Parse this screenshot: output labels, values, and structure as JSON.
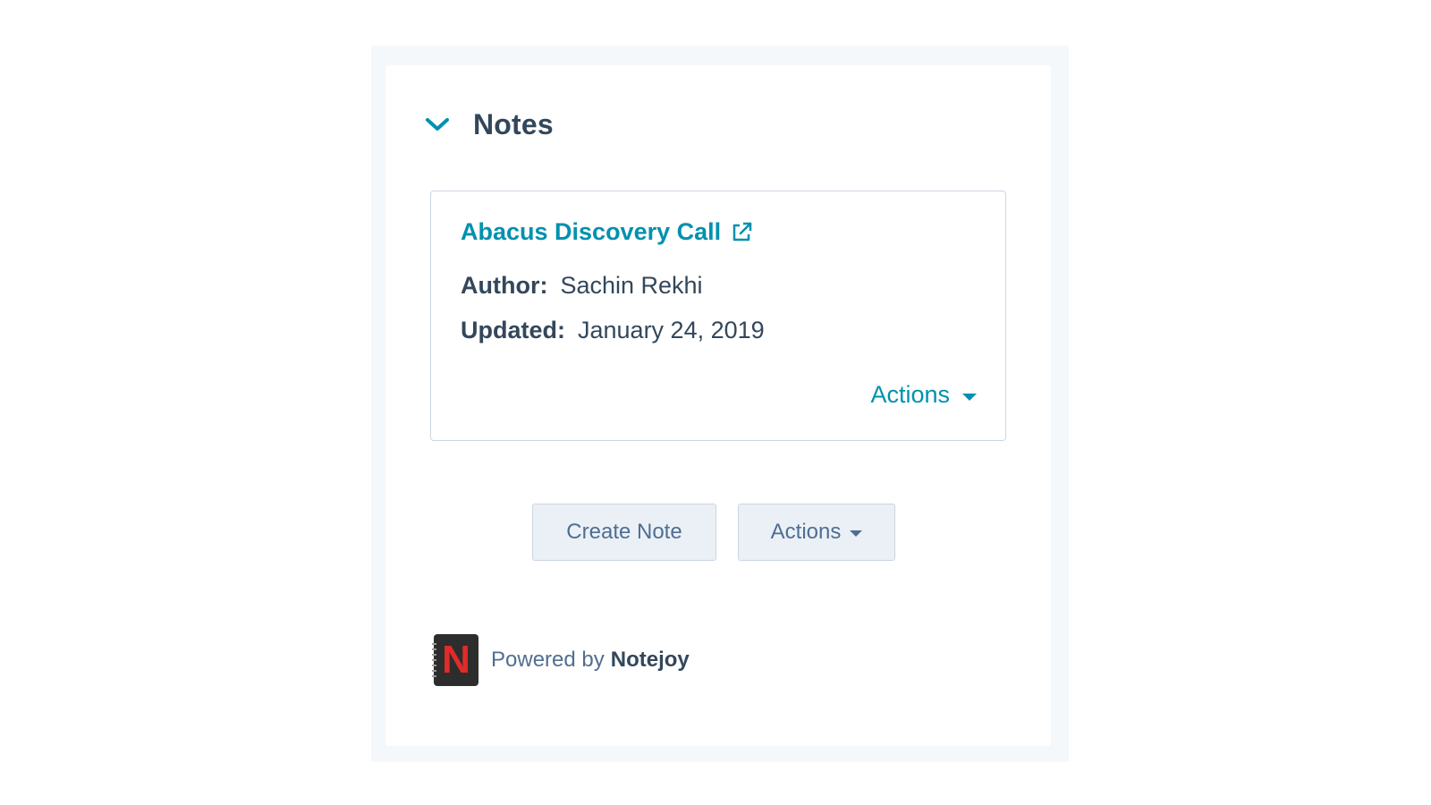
{
  "section": {
    "title": "Notes",
    "chevron_icon": "chevron-down-icon"
  },
  "note": {
    "title": "Abacus Discovery Call",
    "link_icon": "external-link-icon",
    "author_label": "Author:",
    "author_value": "Sachin Rekhi",
    "updated_label": "Updated:",
    "updated_value": "January 24, 2019",
    "actions_label": "Actions"
  },
  "buttons": {
    "create_note": "Create Note",
    "actions": "Actions"
  },
  "footer": {
    "powered_by": "Powered by",
    "brand": "Notejoy",
    "logo_letter": "N"
  },
  "colors": {
    "accent": "#0091ae",
    "heading": "#33475b",
    "button_bg": "#eaf0f6",
    "border": "#cbd6e2",
    "logo_red": "#e02b2b"
  }
}
